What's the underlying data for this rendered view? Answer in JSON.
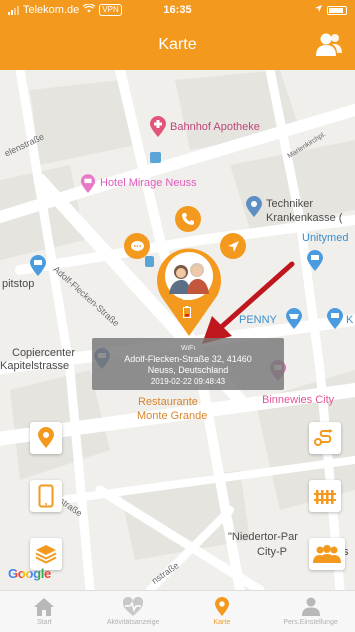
{
  "status": {
    "carrier": "Telekom.de",
    "vpn": "VPN",
    "time": "16:35"
  },
  "header": {
    "title": "Karte",
    "users_icon": "users-icon"
  },
  "map": {
    "pois": {
      "bahnhof_apotheke": "Bahnhof Apotheke",
      "hotel_mirage": "Hotel Mirage Neuss",
      "techniker_1": "Techniker",
      "techniker_2": "Krankenkasse (",
      "unitymed": "Unitymed",
      "pitstop": "pitstop",
      "penny": "PENNY",
      "k": "K",
      "copiercenter_1": "Copiercenter",
      "copiercenter_2": "Kapitelstrasse",
      "restaurant_1": "Restaurante",
      "restaurant_2": "Monte Grande",
      "binnewies": "Binnewies City",
      "niedertor_1": "\"Niedertor-Par",
      "niedertor_2": "City-P",
      "niedertor_s": "s"
    },
    "streets": {
      "s1": "elenstraße",
      "s2": "Adolf-Flecken-Straße",
      "s3": "Marienkirchpl.",
      "s4": "straße",
      "s5": "nstraße"
    },
    "marker": {
      "battery": "1%"
    },
    "infobox": {
      "wifi": "WiFi",
      "address_1": "Adolf-Flecken-Straße 32, 41460",
      "address_2": "Neuss, Deutschland",
      "timestamp": "2019-02-22 09:48:43"
    },
    "google": "Google",
    "colors": {
      "accent": "#f39a1e",
      "arrow": "#c0161d"
    }
  },
  "tabs": [
    {
      "label": "Start",
      "icon": "home-icon"
    },
    {
      "label": "Aktivitätsanzeige",
      "icon": "heartbeat-icon"
    },
    {
      "label": "Karte",
      "icon": "map-pin-icon"
    },
    {
      "label": "Pers.Einstellunge",
      "icon": "person-icon"
    }
  ]
}
